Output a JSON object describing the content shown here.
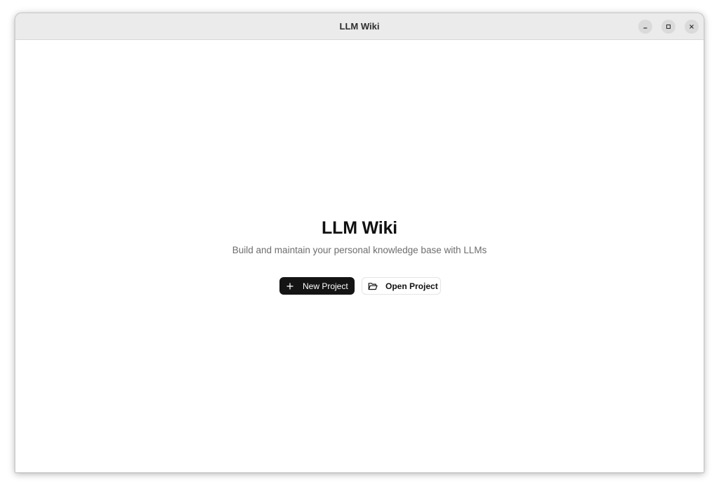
{
  "window": {
    "title": "LLM Wiki",
    "controls": {
      "minimize_icon": "minimize-icon",
      "maximize_icon": "maximize-icon",
      "close_icon": "close-icon"
    }
  },
  "main": {
    "title": "LLM Wiki",
    "subtitle": "Build and maintain your personal knowledge base with LLMs",
    "buttons": {
      "new_project": {
        "label": "New Project",
        "icon": "plus-icon"
      },
      "open_project": {
        "label": "Open Project",
        "icon": "folder-open-icon"
      }
    }
  },
  "colors": {
    "primary_button_bg": "#141414",
    "primary_button_text": "#ffffff",
    "titlebar_bg": "#ebebeb",
    "subtitle_text": "#6d6d6d"
  }
}
